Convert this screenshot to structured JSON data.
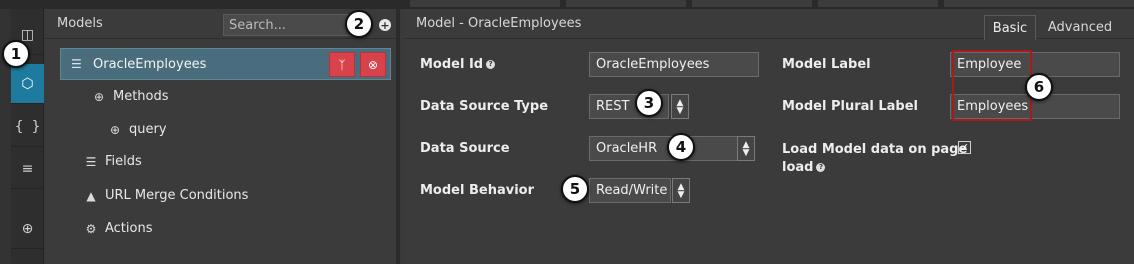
{
  "models_panel": {
    "title": "Models",
    "search_placeholder": "Search...",
    "add_icon": "plus-circle-icon",
    "selected_model": "OracleEmployees",
    "tree": {
      "methods": "Methods",
      "query": "query",
      "fields": "Fields",
      "url_merge": "URL Merge Conditions",
      "actions": "Actions"
    }
  },
  "editor": {
    "title": "Model - OracleEmployees",
    "tabs": {
      "basic": "Basic",
      "advanced": "Advanced"
    },
    "model_id": {
      "label": "Model Id",
      "value": "OracleEmployees"
    },
    "data_source_type": {
      "label": "Data Source Type",
      "value": "REST"
    },
    "data_source": {
      "label": "Data Source",
      "value": "OracleHR"
    },
    "model_behavior": {
      "label": "Model Behavior",
      "value": "Read/Write"
    },
    "model_label": {
      "label": "Model Label",
      "value": "Employee"
    },
    "model_plural_label": {
      "label": "Model Plural Label",
      "value": "Employees"
    },
    "load_on_page_load": {
      "label_line1": "Load Model data on page",
      "label_line2": "load",
      "checked": true
    }
  },
  "callouts": [
    "1",
    "2",
    "3",
    "4",
    "5",
    "6"
  ],
  "colors": {
    "accent": "#1f7aa0",
    "selected_row": "#4a6d7d",
    "danger": "#d8434b",
    "highlight_box": "#a61b1b"
  }
}
